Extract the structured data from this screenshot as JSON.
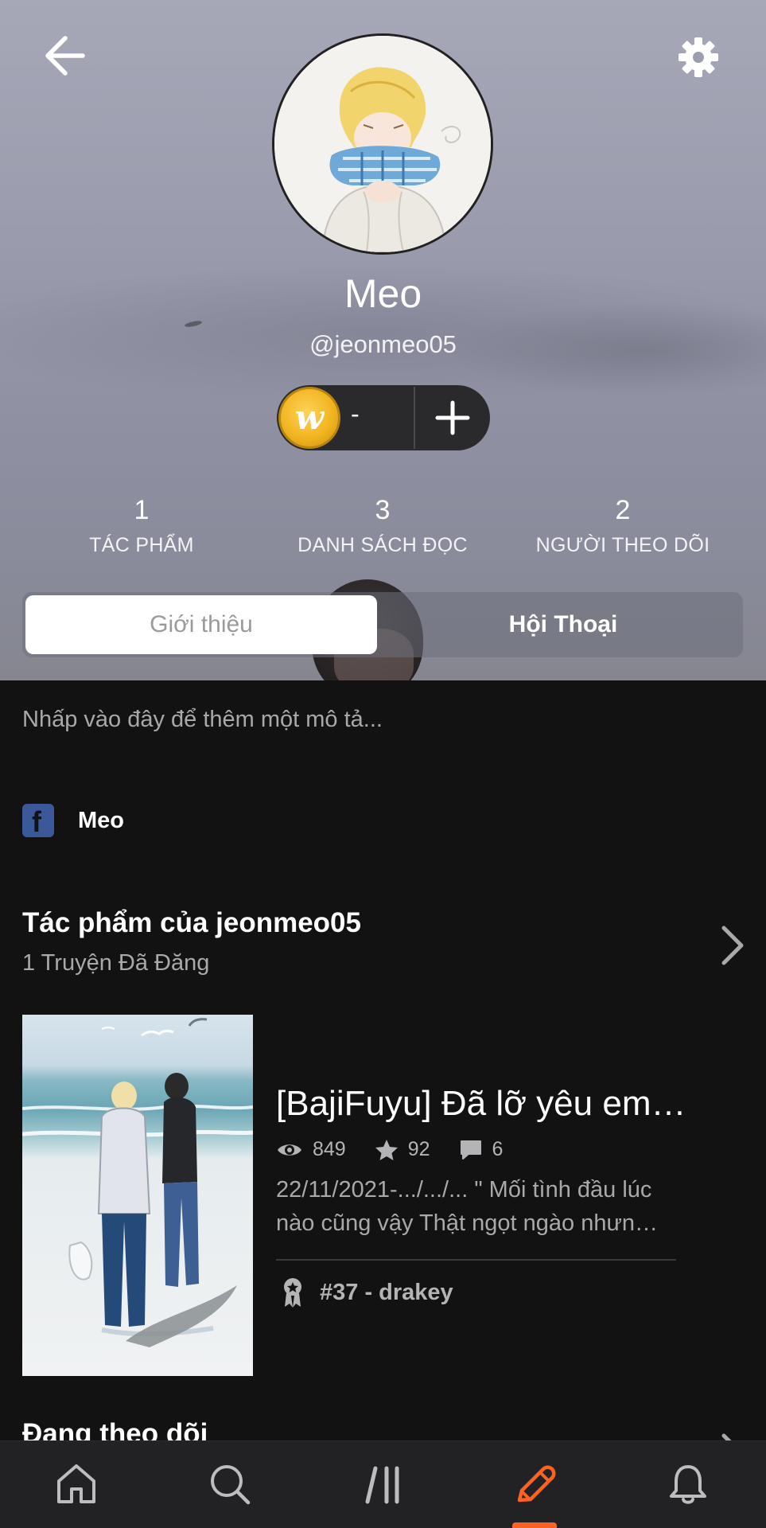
{
  "profile": {
    "display_name": "Meo",
    "username": "@jeonmeo05",
    "coin_letter": "w",
    "coins": "-"
  },
  "stats": [
    {
      "value": "1",
      "label": "TÁC PHẨM"
    },
    {
      "value": "3",
      "label": "DANH SÁCH ĐỌC"
    },
    {
      "value": "2",
      "label": "NGƯỜI THEO DÕI"
    }
  ],
  "tabs": {
    "about": "Giới thiệu",
    "conversations": "Hội Thoại",
    "active": "about"
  },
  "about": {
    "description_placeholder": "Nhấp vào đây để thêm một mô tả...",
    "facebook_name": "Meo"
  },
  "works": {
    "title": "Tác phẩm của jeonmeo05",
    "subtitle": "1 Truyện Đã Đăng"
  },
  "story": {
    "title": "[BajiFuyu] Đã lỡ yêu em…",
    "reads": "849",
    "votes": "92",
    "comments": "6",
    "description_line1": "22/11/2021-.../.../... \" Mối tình đầu lúc",
    "description_line2": "nào cũng vậy Thật ngọt ngào nhưn…",
    "rank": "#37 - drakey"
  },
  "following": {
    "title": "Đang theo dõi"
  },
  "nav": {
    "items": [
      "home-icon",
      "search-icon",
      "library-icon",
      "write-icon",
      "bell-icon"
    ],
    "active": "write-icon"
  },
  "colors": {
    "accent": "#ff6122",
    "background": "#121212",
    "facebook": "#3b5998",
    "coin": "#f2b521"
  }
}
